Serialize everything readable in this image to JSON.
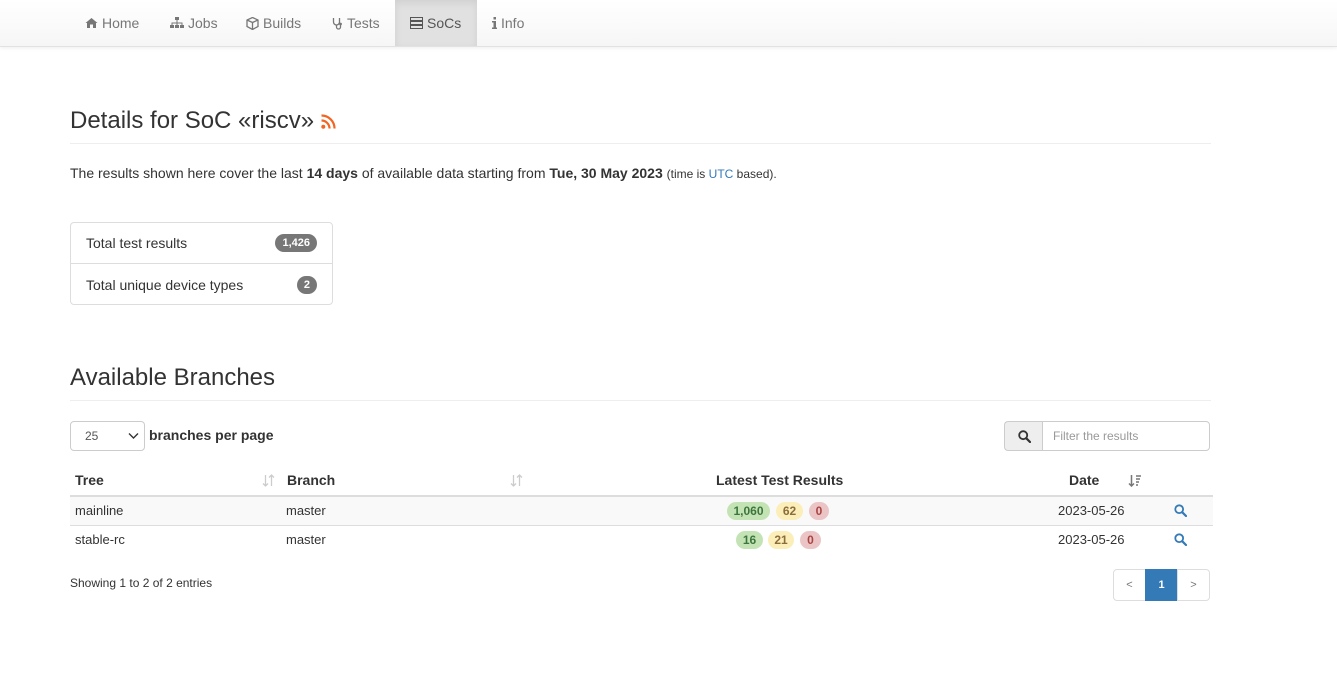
{
  "nav": {
    "items": [
      {
        "label": "Home",
        "icon": "home-icon",
        "active": false
      },
      {
        "label": "Jobs",
        "icon": "sitemap-icon",
        "active": false
      },
      {
        "label": "Builds",
        "icon": "cube-icon",
        "active": false
      },
      {
        "label": "Tests",
        "icon": "stethoscope-icon",
        "active": false
      },
      {
        "label": "SoCs",
        "icon": "server-icon",
        "active": true
      },
      {
        "label": "Info",
        "icon": "info-icon",
        "active": false
      }
    ]
  },
  "page": {
    "title": "Details for SoC «riscv»",
    "rss_icon": "rss-icon",
    "rss_color": "#f26522"
  },
  "intro": {
    "prefix": "The results shown here cover the last",
    "days": "14 days",
    "middle": "of available data starting from",
    "date": "Tue, 30 May 2023",
    "note_open": "(time is",
    "tz": "UTC",
    "note_close": "based)."
  },
  "summary": {
    "total_label": "Total test results",
    "total_value": "1,426",
    "devices_label": "Total unique device types",
    "devices_value": "2"
  },
  "branches": {
    "title": "Available Branches",
    "page_size": "25",
    "per_page_label": "branches per page",
    "search_placeholder": "Filter the results",
    "columns": {
      "tree": "Tree",
      "branch": "Branch",
      "results": "Latest Test Results",
      "date": "Date"
    },
    "rows": [
      {
        "tree": "mainline",
        "branch": "master",
        "pass": "1,060",
        "warn": "62",
        "fail": "0",
        "date": "2023-05-26"
      },
      {
        "tree": "stable-rc",
        "branch": "master",
        "pass": "16",
        "warn": "21",
        "fail": "0",
        "date": "2023-05-26"
      }
    ],
    "info": "Showing 1 to 2 of 2 entries",
    "pagination": {
      "prev": "<",
      "current": "1",
      "next": ">"
    }
  },
  "colors": {
    "accent": "#337ab7",
    "pass_bg": "#c4e3b5",
    "warn_bg": "#fbeeb8",
    "fail_bg": "#ebc5c5",
    "badge": "#777777"
  }
}
